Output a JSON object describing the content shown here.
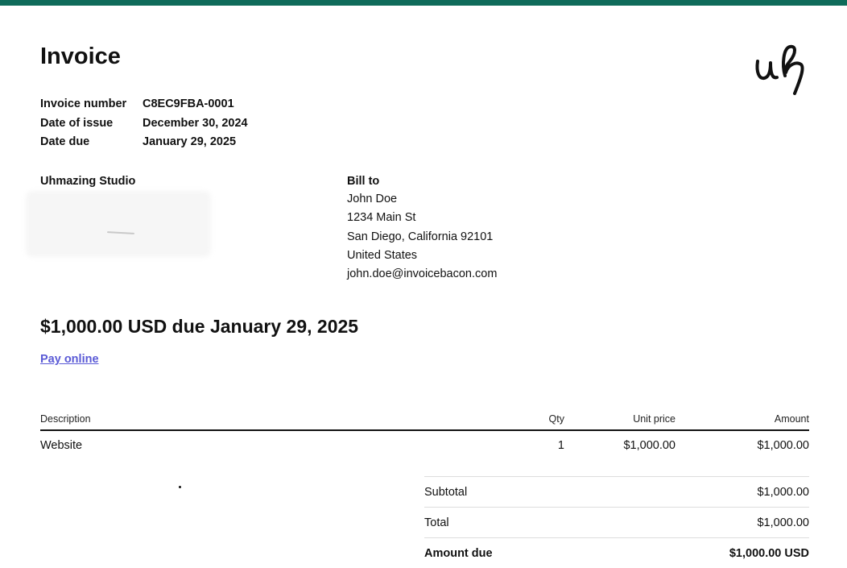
{
  "invoice": {
    "title": "Invoice",
    "meta": [
      {
        "label": "Invoice number",
        "value": "C8EC9FBA-0001"
      },
      {
        "label": "Date of issue",
        "value": "December 30, 2024"
      },
      {
        "label": "Date due",
        "value": "January 29, 2025"
      }
    ]
  },
  "from": {
    "name": "Uhmazing Studio"
  },
  "bill_to": {
    "title": "Bill to",
    "lines": [
      "John Doe",
      "1234 Main St",
      "San Diego, California 92101",
      "United States",
      "john.doe@invoicebacon.com"
    ]
  },
  "summary": {
    "due_text": "$1,000.00 USD due January 29, 2025",
    "pay_link": "Pay online"
  },
  "items": {
    "headers": [
      "Description",
      "Qty",
      "Unit price",
      "Amount"
    ],
    "rows": [
      {
        "description": "Website",
        "qty": "1",
        "unit_price": "$1,000.00",
        "amount": "$1,000.00"
      }
    ]
  },
  "totals": [
    {
      "label": "Subtotal",
      "value": "$1,000.00"
    },
    {
      "label": "Total",
      "value": "$1,000.00"
    },
    {
      "label": "Amount due",
      "value": "$1,000.00 USD"
    }
  ],
  "colors": {
    "accent_bar": "#0f6b5a",
    "link": "#5a5ad6"
  },
  "logo": {
    "icon": "uh-signature-logo-icon"
  }
}
